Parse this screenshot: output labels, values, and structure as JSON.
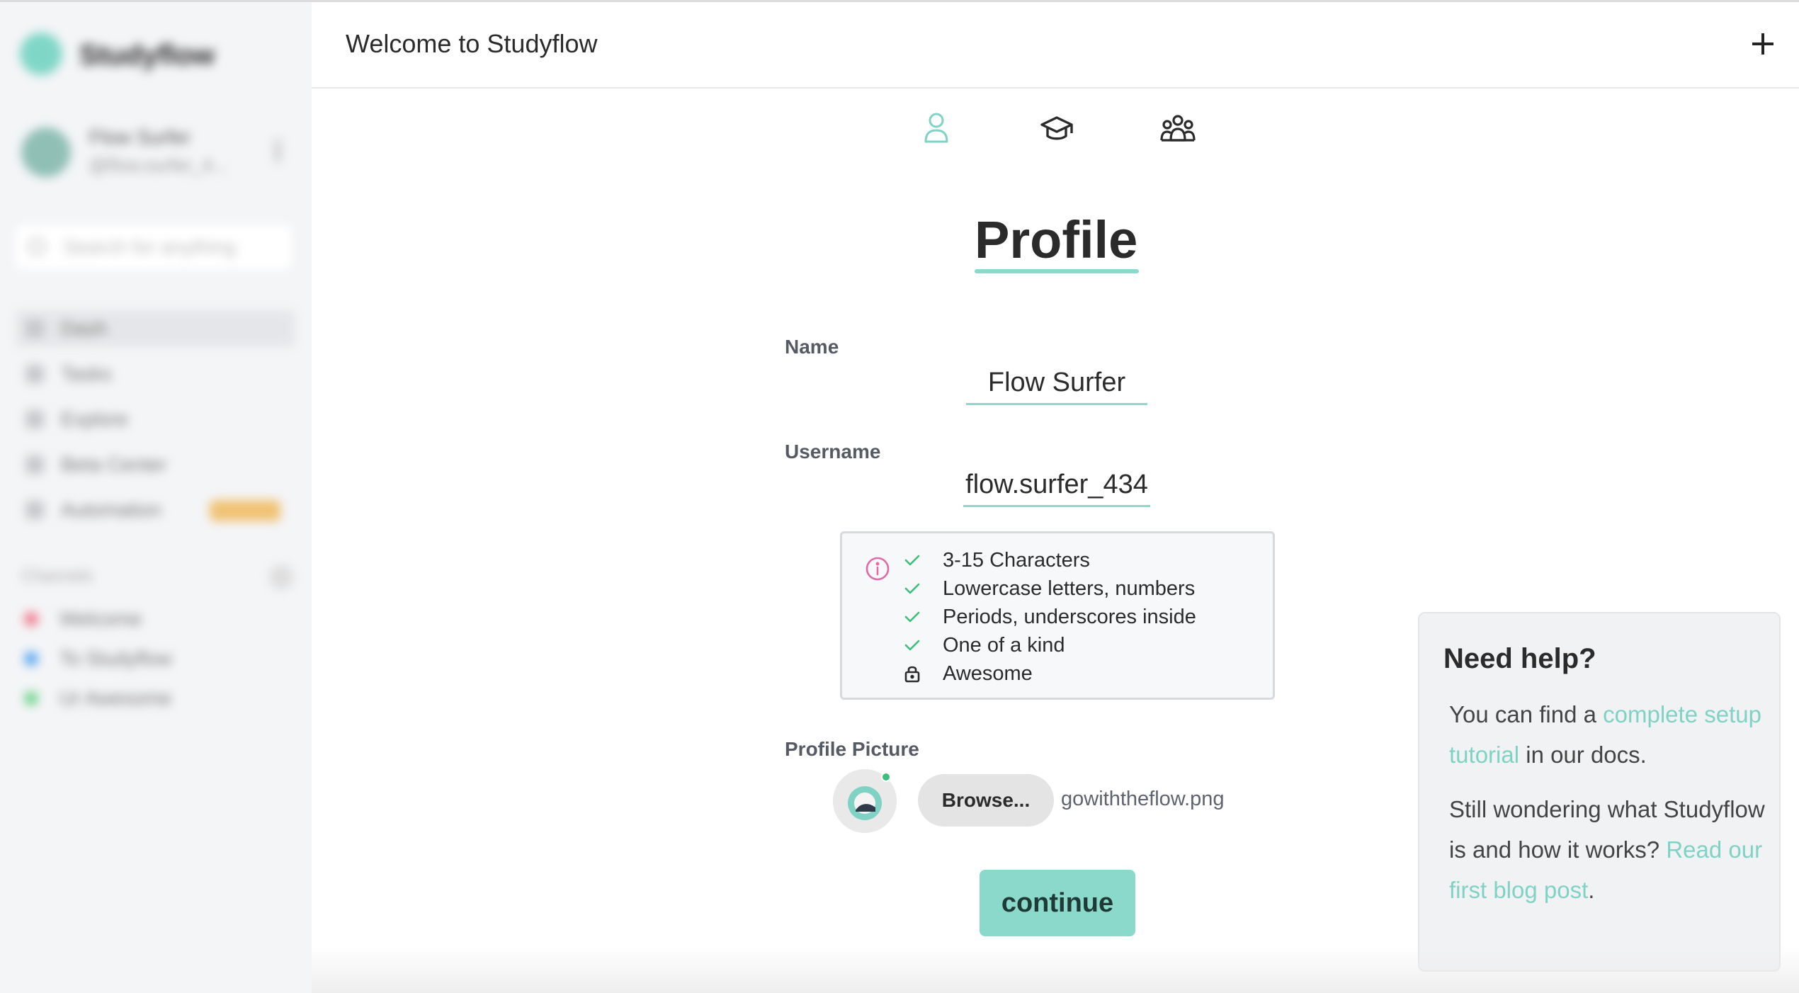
{
  "sidebar": {
    "app_name": "Studyflow",
    "user": {
      "name": "Flow Surfer",
      "handle": "@flow.surfer_4..."
    },
    "search_placeholder": "Search for anything",
    "nav": [
      {
        "label": "Dash"
      },
      {
        "label": "Tasks"
      },
      {
        "label": "Explore"
      },
      {
        "label": "Beta Center"
      },
      {
        "label": "Automation",
        "badge": "SUPER"
      }
    ],
    "section_title": "Channels",
    "channels": [
      {
        "label": "Welcome",
        "color": "#f07c8c"
      },
      {
        "label": "To Studyflow",
        "color": "#5aa8f0"
      },
      {
        "label": "Ur Awesome",
        "color": "#6fd48a"
      }
    ]
  },
  "header": {
    "title": "Welcome to Studyflow"
  },
  "steps": [
    {
      "name": "profile-step",
      "active": true,
      "color": "#7fd2c4"
    },
    {
      "name": "education-step",
      "active": false,
      "color": "#2b2b2b"
    },
    {
      "name": "team-step",
      "active": false,
      "color": "#2b2b2b"
    }
  ],
  "form": {
    "title": "Profile",
    "name_label": "Name",
    "name_value": "Flow Surfer",
    "username_label": "Username",
    "username_value": "flow.surfer_434",
    "rules": [
      {
        "text": "3-15 Characters",
        "status": "check"
      },
      {
        "text": "Lowercase letters, numbers",
        "status": "check"
      },
      {
        "text": "Periods, underscores inside",
        "status": "check"
      },
      {
        "text": "One of a kind",
        "status": "check"
      },
      {
        "text": "Awesome",
        "status": "lock"
      }
    ],
    "picture_label": "Profile Picture",
    "browse_label": "Browse...",
    "file_name": "gowiththeflow.png",
    "continue_label": "continue"
  },
  "help": {
    "title": "Need help?",
    "p1_before": "You can find a ",
    "p1_link": "complete setup tutorial",
    "p1_after": " in our docs.",
    "p2_before": "Still wondering what Studyflow is and how it works? ",
    "p2_link": "Read our first blog post",
    "p2_after": "."
  },
  "colors": {
    "accent": "#8ad9cb",
    "check": "#3cbf7a",
    "info": "#e36aa6"
  }
}
